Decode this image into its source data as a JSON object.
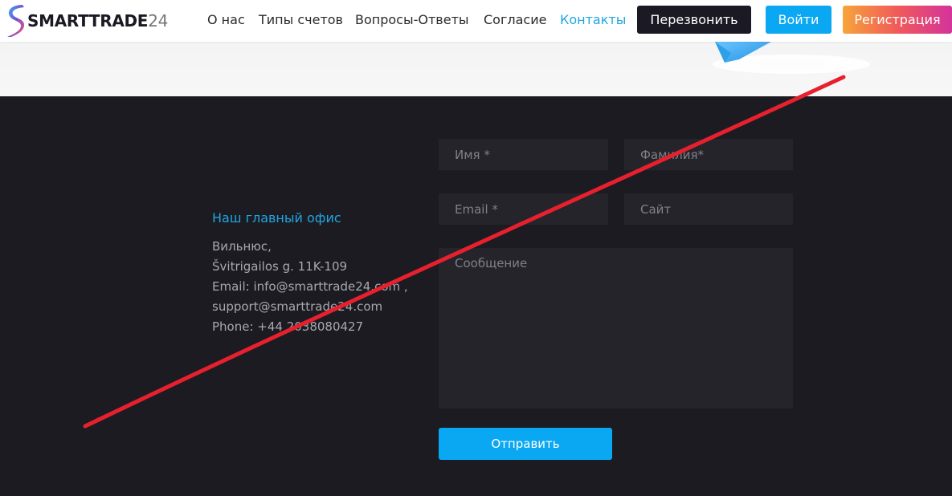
{
  "header": {
    "logo_text": "SMARTTRADE",
    "logo_number": "24",
    "nav": [
      {
        "label": "О нас"
      },
      {
        "label": "Типы счетов"
      },
      {
        "label": "Вопросы-Ответы"
      },
      {
        "label": "Согласие"
      },
      {
        "label": "Контакты",
        "active": true
      }
    ],
    "callback_label": "Перезвонить",
    "login_label": "Войти",
    "register_label": "Регистрация"
  },
  "office": {
    "title": "Наш главный офис",
    "lines": [
      "Вильнюс,",
      "Švitrigailos g. 11K-109",
      "Email: info@smarttrade24.com ,",
      "support@smarttrade24.com",
      "Phone: +44 2038080427"
    ]
  },
  "form": {
    "first_name_placeholder": "Имя *",
    "last_name_placeholder": "Фамилия*",
    "email_placeholder": "Email *",
    "site_placeholder": "Сайт",
    "message_placeholder": "Сообщение",
    "submit_label": "Отправить"
  },
  "colors": {
    "accent": "#0aa8f3",
    "dark_bg": "#1c1b22",
    "field_bg": "#25242b",
    "link": "#1fa6e0",
    "overlay_line": "#e8202e"
  }
}
